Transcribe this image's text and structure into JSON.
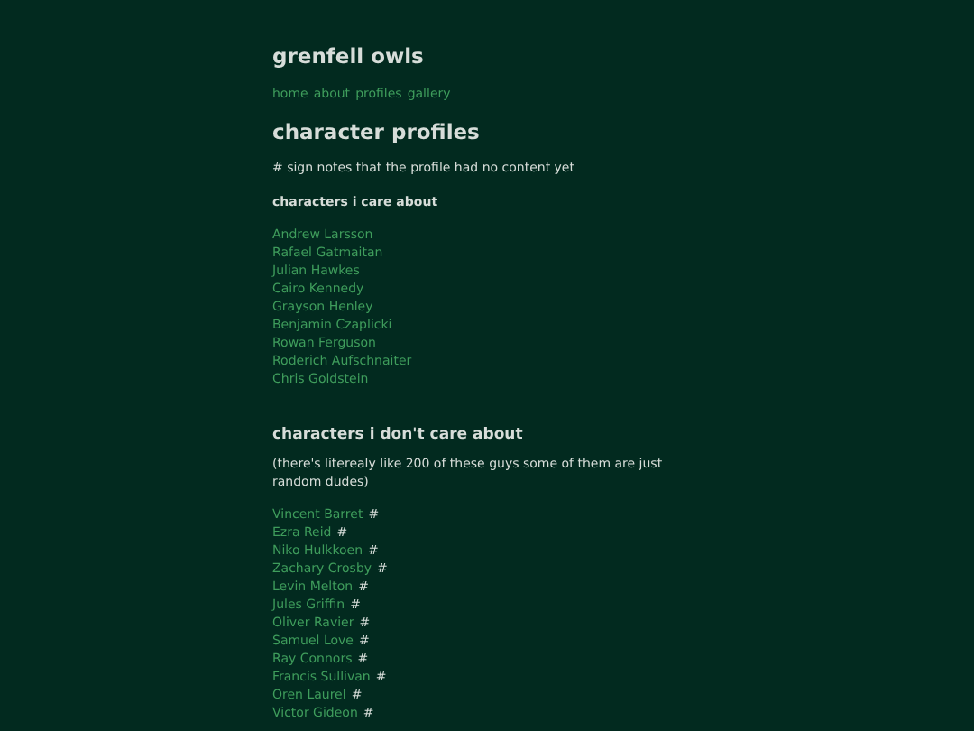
{
  "site_title": "grenfell owls",
  "nav": [
    "home",
    "about",
    "profiles",
    "gallery"
  ],
  "page_title": "character profiles",
  "note": "# sign notes that the profile had no content yet",
  "sections": [
    {
      "heading": "characters i care about",
      "items": [
        {
          "name": "Andrew Larsson"
        },
        {
          "name": "Rafael Gatmaitan"
        },
        {
          "name": "Julian Hawkes"
        },
        {
          "name": "Cairo Kennedy"
        },
        {
          "name": "Grayson Henley"
        },
        {
          "name": "Benjamin Czaplicki"
        },
        {
          "name": "Rowan Ferguson"
        },
        {
          "name": "Roderich Aufschnaiter"
        },
        {
          "name": "Chris Goldstein"
        }
      ]
    },
    {
      "heading": "characters i don't care about",
      "description": "(there's literealy like 200 of these guys some of them are just random dudes)",
      "items": [
        {
          "name": "Vincent Barret",
          "mark": "#"
        },
        {
          "name": "Ezra Reid",
          "mark": "#"
        },
        {
          "name": "Niko Hulkkoen",
          "mark": "#"
        },
        {
          "name": "Zachary Crosby",
          "mark": "#"
        },
        {
          "name": "Levin Melton",
          "mark": "#"
        },
        {
          "name": "Jules Griffin",
          "mark": "#"
        },
        {
          "name": "Oliver Ravier",
          "mark": "#"
        },
        {
          "name": "Samuel Love",
          "mark": "#"
        },
        {
          "name": "Ray Connors",
          "mark": "#"
        },
        {
          "name": "Francis Sullivan",
          "mark": "#"
        },
        {
          "name": "Oren Laurel",
          "mark": "#"
        },
        {
          "name": "Victor Gideon",
          "mark": "#"
        }
      ]
    }
  ]
}
